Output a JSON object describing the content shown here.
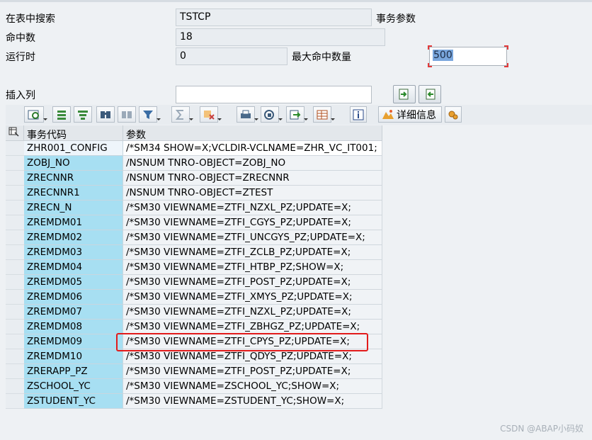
{
  "form": {
    "search_label": "在表中搜索",
    "search_value": "TSTCP",
    "search_suffix": "事务参数",
    "hits_label": "命中数",
    "hits_value": "18",
    "runtime_label": "运行时",
    "runtime_value": "0",
    "max_hits_label": "最大命中数量",
    "max_hits_value": "500",
    "insert_col_label": "插入列",
    "insert_col_value": ""
  },
  "toolbar": {
    "details_label": "详细信息",
    "icons": [
      "grid-refresh-icon",
      "sort-ascending-icon",
      "sort-descending-icon",
      "find-icon",
      "find-next-icon",
      "filter-icon",
      "total-icon",
      "subtotal-icon",
      "print-icon",
      "view-icon",
      "export-icon",
      "layout-icon",
      "info-icon",
      "details-icon",
      "settings-icon"
    ]
  },
  "table": {
    "headers": [
      "事务代码",
      "参数"
    ],
    "rows": [
      {
        "code": "ZHR001_CONFIG",
        "param": "/*SM34 SHOW=X;VCLDIR-VCLNAME=ZHR_VC_IT001;"
      },
      {
        "code": "ZOBJ_NO",
        "param": "/NSNUM TNRO-OBJECT=ZOBJ_NO"
      },
      {
        "code": "ZRECNNR",
        "param": "/NSNUM TNRO-OBJECT=ZRECNNR"
      },
      {
        "code": "ZRECNNR1",
        "param": "/NSNUM TNRO-OBJECT=ZTEST"
      },
      {
        "code": "ZRECN_N",
        "param": "/*SM30 VIEWNAME=ZTFI_NZXL_PZ;UPDATE=X;"
      },
      {
        "code": "ZREMDM01",
        "param": "/*SM30 VIEWNAME=ZTFI_CGYS_PZ;UPDATE=X;"
      },
      {
        "code": "ZREMDM02",
        "param": "/*SM30 VIEWNAME=ZTFI_UNCGYS_PZ;UPDATE=X;"
      },
      {
        "code": "ZREMDM03",
        "param": "/*SM30 VIEWNAME=ZTFI_ZCLB_PZ;UPDATE=X;"
      },
      {
        "code": "ZREMDM04",
        "param": "/*SM30 VIEWNAME=ZTFI_HTBP_PZ;SHOW=X;"
      },
      {
        "code": "ZREMDM05",
        "param": "/*SM30 VIEWNAME=ZTFI_POST_PZ;UPDATE=X;"
      },
      {
        "code": "ZREMDM06",
        "param": "/*SM30 VIEWNAME=ZTFI_XMYS_PZ;UPDATE=X;"
      },
      {
        "code": "ZREMDM07",
        "param": "/*SM30 VIEWNAME=ZTFI_NZXL_PZ;UPDATE=X;"
      },
      {
        "code": "ZREMDM08",
        "param": "/*SM30 VIEWNAME=ZTFI_ZBHGZ_PZ;UPDATE=X;"
      },
      {
        "code": "ZREMDM09",
        "param": "/*SM30 VIEWNAME=ZTFI_CPYS_PZ;UPDATE=X;"
      },
      {
        "code": "ZREMDM10",
        "param": "/*SM30 VIEWNAME=ZTFI_QDYS_PZ;UPDATE=X;"
      },
      {
        "code": "ZRERAPP_PZ",
        "param": "/*SM30 VIEWNAME=ZTFI_POST_PZ;UPDATE=X;"
      },
      {
        "code": "ZSCHOOL_YC",
        "param": "/*SM30 VIEWNAME=ZSCHOOL_YC;SHOW=X;"
      },
      {
        "code": "ZSTUDENT_YC",
        "param": "/*SM30 VIEWNAME=ZSTUDENT_YC;SHOW=X;"
      }
    ]
  },
  "watermark": "CSDN @ABAP小码奴",
  "colors": {
    "code_cell": "#a7dff2",
    "highlight_box": "#e21b1b"
  }
}
